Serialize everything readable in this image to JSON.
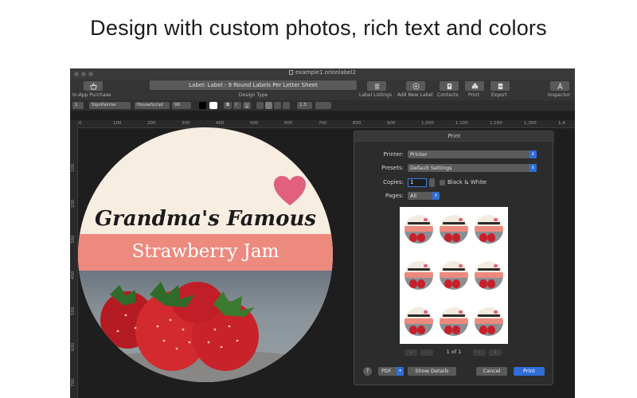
{
  "promo": {
    "headline": "Design with custom photos, rich text and colors"
  },
  "window": {
    "title": "example1.orionlabel2"
  },
  "toolbar": {
    "in_app_purchase": "In-App Purchase",
    "design_type_value": "Label: Label - 9 Round Labels Per Letter Sheet",
    "design_type_label": "Design Type",
    "buttons": [
      {
        "label": "Label Listings",
        "icon": "list-icon"
      },
      {
        "label": "Add New Label",
        "icon": "plus-icon"
      },
      {
        "label": "Contacts",
        "icon": "contact-card-icon"
      },
      {
        "label": "Print",
        "icon": "printer-icon"
      },
      {
        "label": "Export",
        "icon": "export-icon"
      },
      {
        "label": "Inspector",
        "icon": "inspector-icon"
      }
    ]
  },
  "format_bar": {
    "layer": "1",
    "font_family": "SignPainter",
    "font_style": "HouseScript",
    "font_size": "96",
    "bold": "B",
    "italic": "I",
    "underline": "U",
    "line_spacing": "1.3"
  },
  "ruler": {
    "top": [
      "0",
      "100",
      "200",
      "300",
      "400",
      "500",
      "600",
      "700",
      "800",
      "900",
      "1,000",
      "1,100",
      "1,200",
      "1,300",
      "1,4"
    ],
    "left": [
      "100",
      "200",
      "300",
      "400",
      "500",
      "600",
      "700"
    ]
  },
  "label": {
    "line1": "Grandma's Famous",
    "line2": "Strawberry Jam"
  },
  "print_dialog": {
    "title": "Print",
    "printer_label": "Printer:",
    "printer_value": "Printer",
    "presets_label": "Presets:",
    "presets_value": "Default Settings",
    "copies_label": "Copies:",
    "copies_value": "1",
    "bw_label": "Black & White",
    "pages_label": "Pages:",
    "pages_value": "All",
    "page_indicator": "1 of 1",
    "help": "?",
    "pdf": "PDF",
    "show_details": "Show Details",
    "cancel": "Cancel",
    "print": "Print"
  },
  "colors": {
    "accent_blue": "#2f6ed6",
    "band_salmon": "#ec8a7e",
    "heart_pink": "#e0607e",
    "label_cream": "#f7ede1"
  }
}
